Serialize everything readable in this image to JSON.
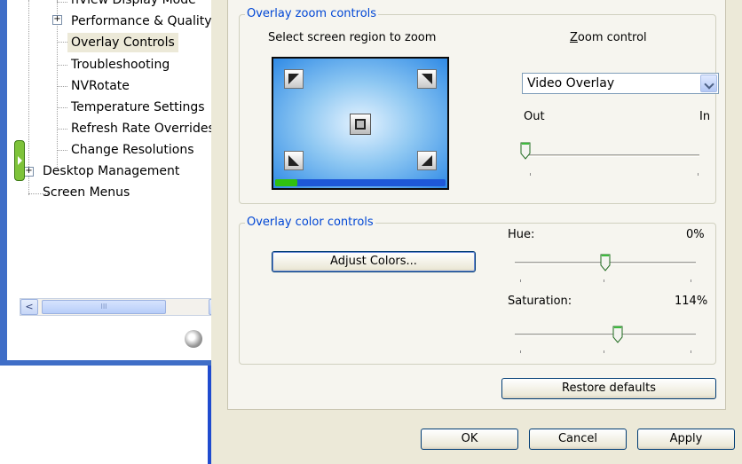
{
  "nav": {
    "items": [
      {
        "label": "nView Display Mode",
        "expander": ""
      },
      {
        "label": "Performance & Quality S",
        "expander": "+"
      },
      {
        "label": "Overlay Controls",
        "expander": ""
      },
      {
        "label": "Troubleshooting",
        "expander": ""
      },
      {
        "label": "NVRotate",
        "expander": ""
      },
      {
        "label": "Temperature Settings",
        "expander": ""
      },
      {
        "label": "Refresh Rate Overrides",
        "expander": ""
      },
      {
        "label": "Change Resolutions",
        "expander": ""
      },
      {
        "label": "Desktop Management",
        "expander": "+"
      },
      {
        "label": "Screen Menus",
        "expander": ""
      }
    ],
    "selected_label": "Overlay Controls",
    "scroll_left_glyph": "<",
    "scroll_right_glyph": ">",
    "scroll_thumb_grip": "III"
  },
  "zoom_group": {
    "title": "Overlay zoom controls",
    "region_label": "Select screen region to zoom",
    "zoom_control_label": "Zoom control",
    "zoom_control_hotkey": "Z",
    "zoom_control_rest": "oom control",
    "selected_option": "Video Overlay",
    "out_label": "Out",
    "in_label": "In",
    "zoom_level": 0,
    "zoom_progress": 0.13
  },
  "color_group": {
    "title": "Overlay color controls",
    "adjust_button": "Adjust Colors...",
    "hue_label": "Hue:",
    "hue_value": "0%",
    "hue_position": 0.5,
    "saturation_label": "Saturation:",
    "saturation_value": "114%",
    "saturation_position": 0.57
  },
  "buttons": {
    "restore_defaults": "Restore defaults",
    "ok": "OK",
    "cancel": "Cancel",
    "apply": "Apply"
  },
  "colors": {
    "group_title": "#0046d5",
    "window_border": "#3f6ec7",
    "taskbar_blue": "#1f4bcf"
  }
}
